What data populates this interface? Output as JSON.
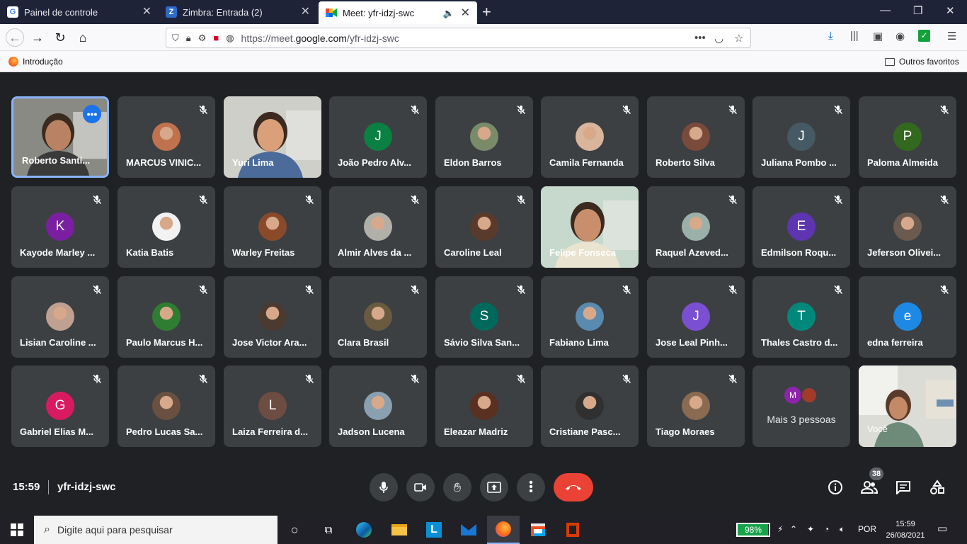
{
  "browser": {
    "tabs": [
      {
        "label": "Painel de controle",
        "icon": "google-icon"
      },
      {
        "label": "Zimbra: Entrada (2)",
        "icon": "zimbra-icon"
      },
      {
        "label": "Meet: yfr-idzj-swc",
        "icon": "meet-icon",
        "active": true
      }
    ],
    "url_prefix": "https://meet.",
    "url_domain": "google.com",
    "url_path": "/yfr-idzj-swc",
    "bookmarks": [
      {
        "label": "Introdução"
      }
    ],
    "other_bookmarks": "Outros favoritos"
  },
  "meet": {
    "participants": [
      {
        "name": "Roberto Santi...",
        "type": "video",
        "self_highlight": true
      },
      {
        "name": "MARCUS VINIC...",
        "type": "photo",
        "color": "#c0714e"
      },
      {
        "name": "Yuri Lima",
        "type": "video"
      },
      {
        "name": "João Pedro Alv...",
        "type": "letter",
        "letter": "J",
        "color": "#0b8043"
      },
      {
        "name": "Eldon Barros",
        "type": "photo",
        "color": "#7a8b6a"
      },
      {
        "name": "Camila Fernanda",
        "type": "photo",
        "color": "#d9b59b"
      },
      {
        "name": "Roberto Silva",
        "type": "photo",
        "color": "#7a4a3a"
      },
      {
        "name": "Juliana Pombo ...",
        "type": "letter",
        "letter": "J",
        "color": "#455a64"
      },
      {
        "name": "Paloma Almeida",
        "type": "letter",
        "letter": "P",
        "color": "#33691e"
      },
      {
        "name": "Kayode Marley ...",
        "type": "letter",
        "letter": "K",
        "color": "#7b1fa2"
      },
      {
        "name": "Katia Batis",
        "type": "photo",
        "color": "#f2f2f2"
      },
      {
        "name": "Warley Freitas",
        "type": "photo",
        "color": "#8a4a2a"
      },
      {
        "name": "Almir Alves da ...",
        "type": "photo",
        "color": "#b0b0a8"
      },
      {
        "name": "Caroline Leal",
        "type": "photo",
        "color": "#5a3a2a"
      },
      {
        "name": "Felipe Fonseca",
        "type": "video"
      },
      {
        "name": "Raquel Azeved...",
        "type": "photo",
        "color": "#9bb0a8"
      },
      {
        "name": "Edmilson Roqu...",
        "type": "letter",
        "letter": "E",
        "color": "#5e35b1"
      },
      {
        "name": "Jeferson Olivei...",
        "type": "photo",
        "color": "#6a5a50"
      },
      {
        "name": "Lisian Caroline ...",
        "type": "photo",
        "color": "#c0a090"
      },
      {
        "name": "Paulo Marcus H...",
        "type": "photo",
        "color": "#2e7d32"
      },
      {
        "name": "Jose Victor Ara...",
        "type": "photo",
        "color": "#4a3a30"
      },
      {
        "name": "Clara Brasil",
        "type": "photo",
        "color": "#6a5a40"
      },
      {
        "name": "Sávio Silva San...",
        "type": "letter",
        "letter": "S",
        "color": "#00695c"
      },
      {
        "name": "Fabiano Lima",
        "type": "photo",
        "color": "#5a8ab0"
      },
      {
        "name": "Jose Leal Pinh...",
        "type": "letter",
        "letter": "J",
        "color": "#7b4fd1"
      },
      {
        "name": "Thales Castro d...",
        "type": "letter",
        "letter": "T",
        "color": "#00897b"
      },
      {
        "name": "edna ferreira",
        "type": "letter",
        "letter": "e",
        "color": "#1e88e5"
      },
      {
        "name": "Gabriel Elias M...",
        "type": "letter",
        "letter": "G",
        "color": "#d81b60"
      },
      {
        "name": "Pedro Lucas Sa...",
        "type": "photo",
        "color": "#6a5040"
      },
      {
        "name": "Laiza Ferreira d...",
        "type": "letter",
        "letter": "L",
        "color": "#6d4c41"
      },
      {
        "name": "Jadson Lucena",
        "type": "photo",
        "color": "#8aa0b0"
      },
      {
        "name": "Eleazar Madriz",
        "type": "photo",
        "color": "#5a3020"
      },
      {
        "name": "Cristiane Pasc...",
        "type": "photo",
        "color": "#303030"
      },
      {
        "name": "Tiago Moraes",
        "type": "photo",
        "color": "#8a6a50"
      }
    ],
    "more_people": {
      "label": "Mais 3 pessoas",
      "letter": "M",
      "letter_color": "#8e24aa"
    },
    "self_tile": {
      "name": "Você"
    },
    "clock": "15:59",
    "meeting_code": "yfr-idzj-swc",
    "participant_count": "38"
  },
  "taskbar": {
    "search_placeholder": "Digite aqui para pesquisar",
    "battery": "98%",
    "battery_level": 0.98,
    "language": "POR",
    "time": "15:59",
    "date": "26/08/2021"
  }
}
